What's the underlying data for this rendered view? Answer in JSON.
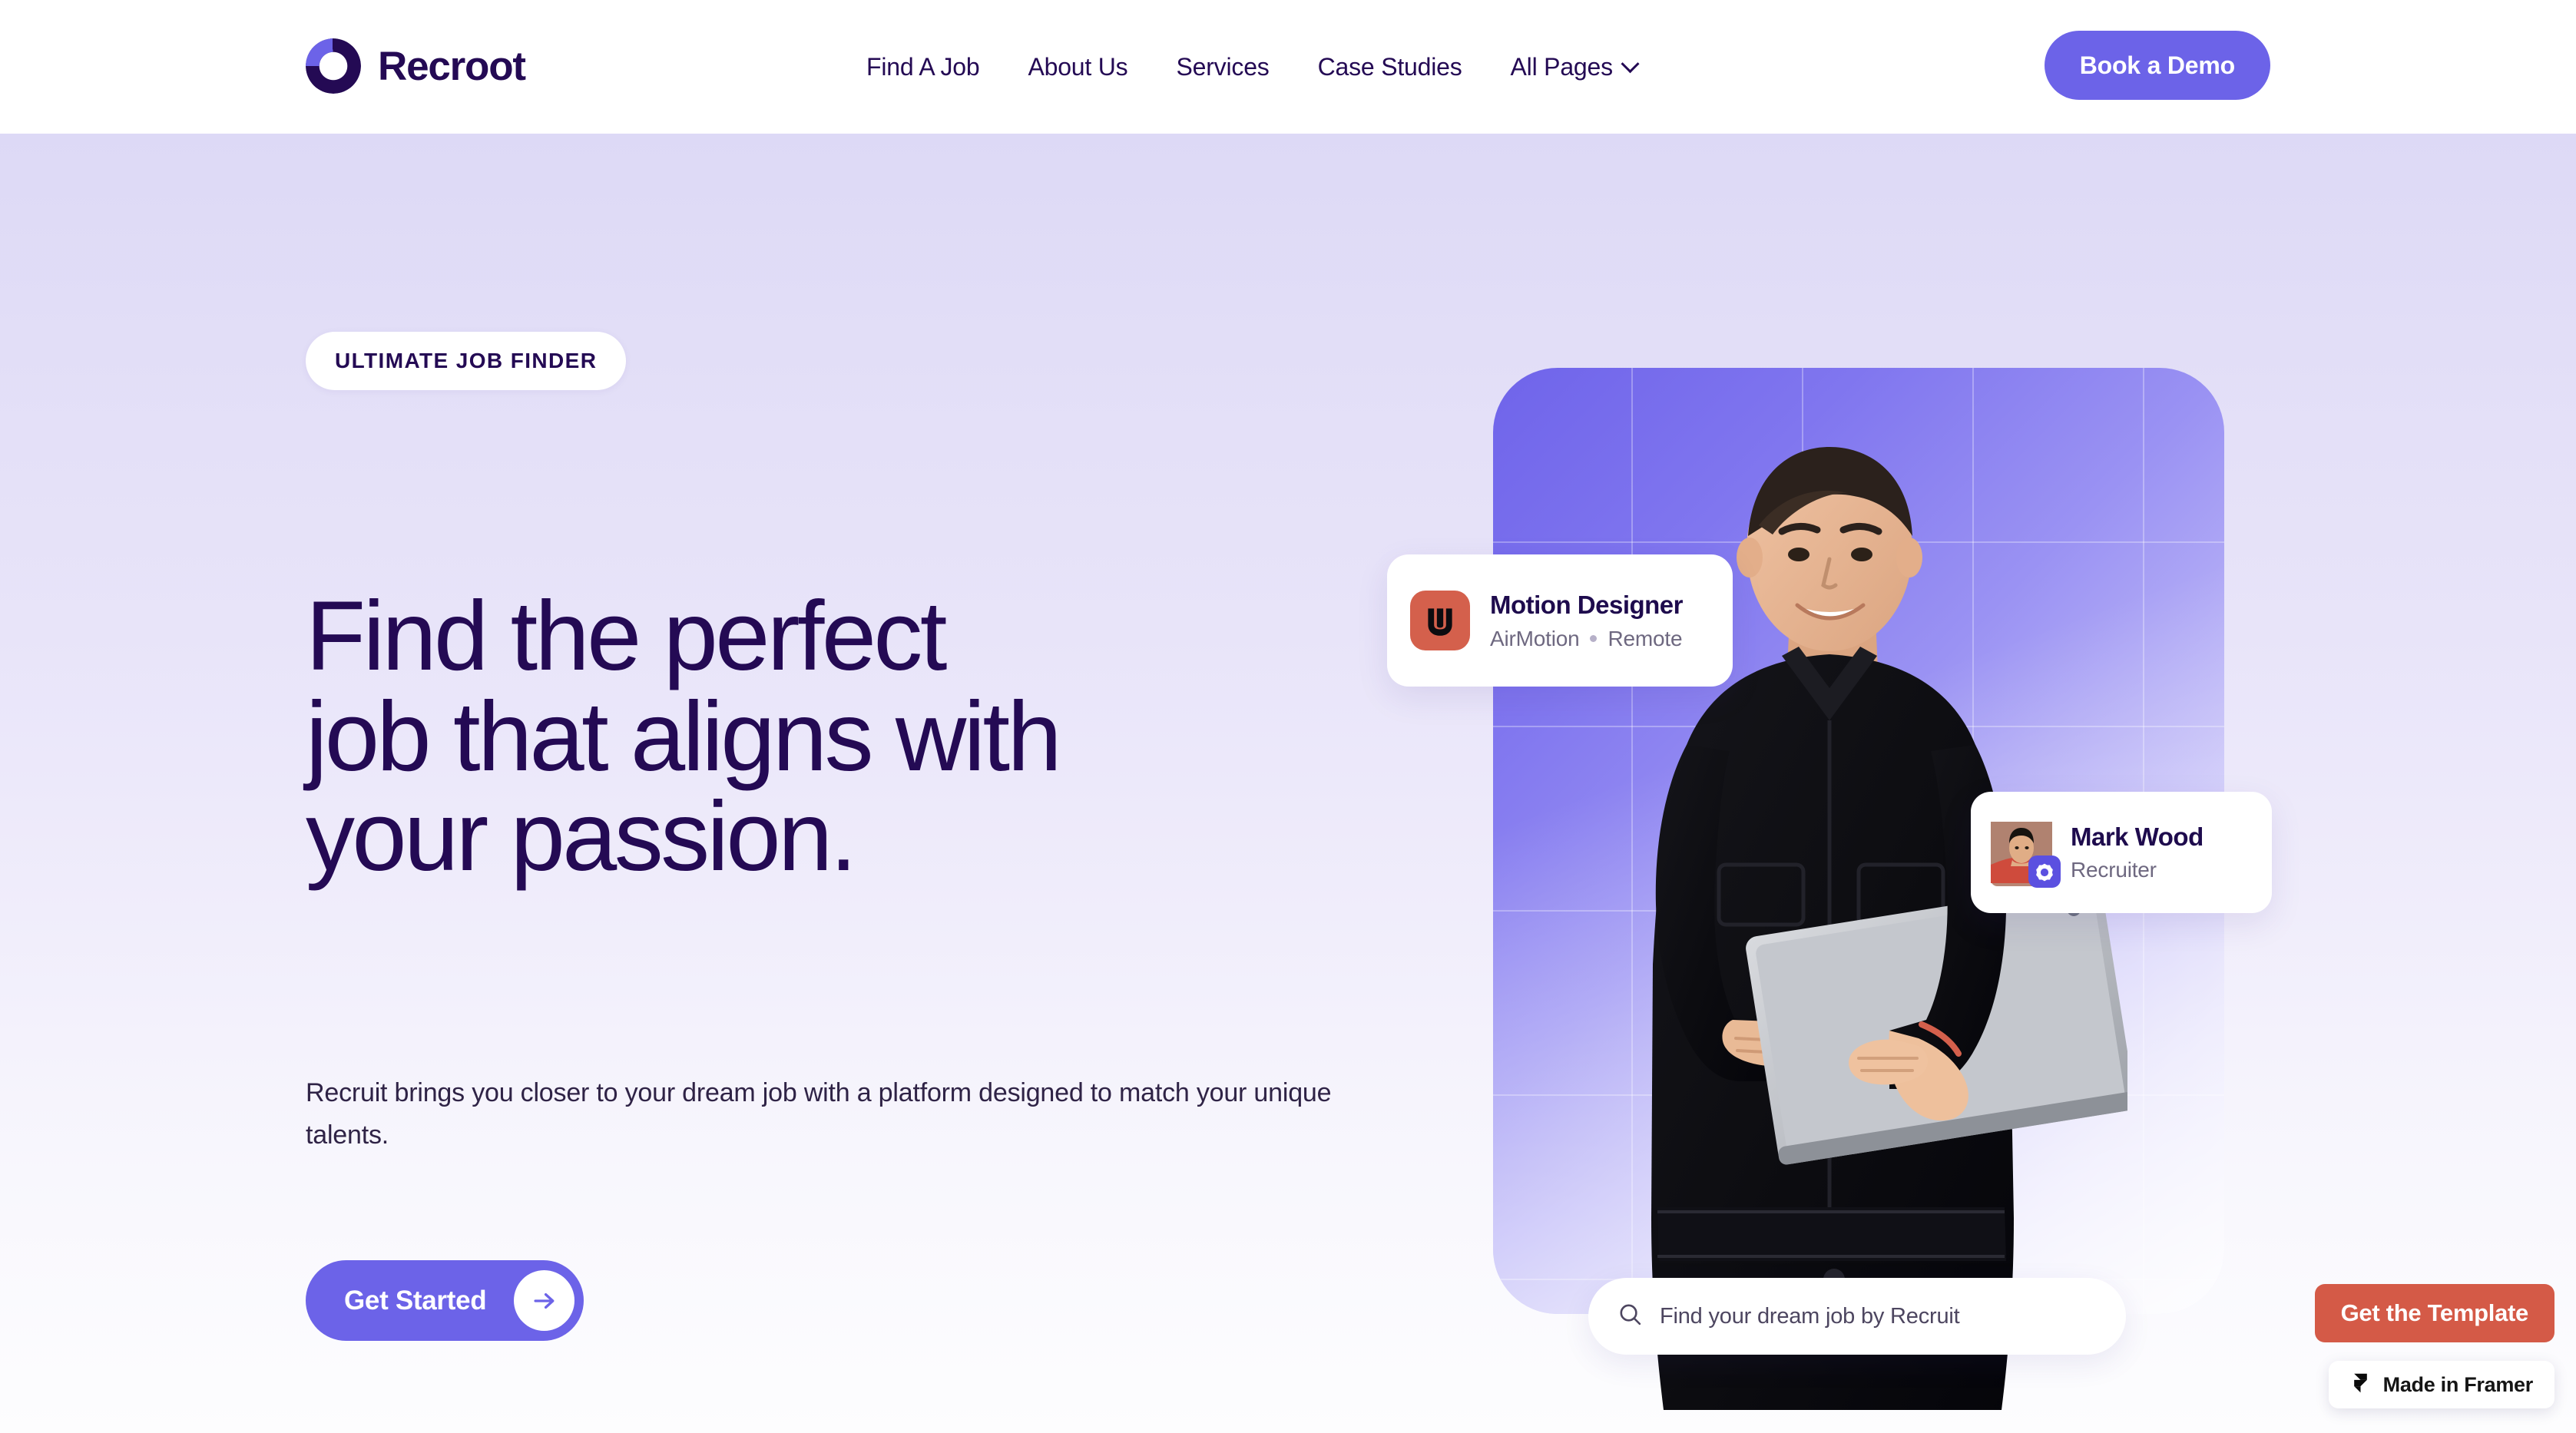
{
  "brand": {
    "name": "Recroot",
    "logo_icon": "recroot-ring-logo"
  },
  "nav": {
    "items": [
      {
        "label": "Find A Job"
      },
      {
        "label": "About Us"
      },
      {
        "label": "Services"
      },
      {
        "label": "Case Studies"
      },
      {
        "label": "All Pages",
        "icon": "chevron-down-icon",
        "has_dropdown": true
      }
    ],
    "cta": {
      "label": "Book a Demo",
      "color": "#6c63e8"
    }
  },
  "hero": {
    "badge": "ULTIMATE JOB FINDER",
    "headline_lines": [
      "Find the perfect",
      "job that aligns with",
      "your passion."
    ],
    "subhead": "Recruit brings you closer to your dream job with a platform designed to match your unique talents.",
    "cta": {
      "label": "Get Started",
      "icon": "arrow-right-icon",
      "color": "#6c63e8"
    }
  },
  "job_card": {
    "company_logo_icon": "airmotion-w-logo",
    "company_logo_color": "#d4604c",
    "title": "Motion Designer",
    "company": "AirMotion",
    "location": "Remote"
  },
  "recruiter_card": {
    "avatar_icon": "recruiter-avatar",
    "verified_icon": "verified-badge-icon",
    "name": "Mark Wood",
    "role": "Recruiter"
  },
  "search": {
    "icon": "search-icon",
    "placeholder": "Find your dream job by Recruit"
  },
  "widgets": {
    "template_button": {
      "label": "Get the Template",
      "color": "#d45a47"
    },
    "framer_badge": {
      "label": "Made in Framer",
      "icon": "framer-logo-icon"
    }
  },
  "theme": {
    "accent": "#6c63e8",
    "ink": "#240a54",
    "page_bg_top": "#ddd9f6",
    "page_bg_bottom": "#fdfdfe"
  }
}
